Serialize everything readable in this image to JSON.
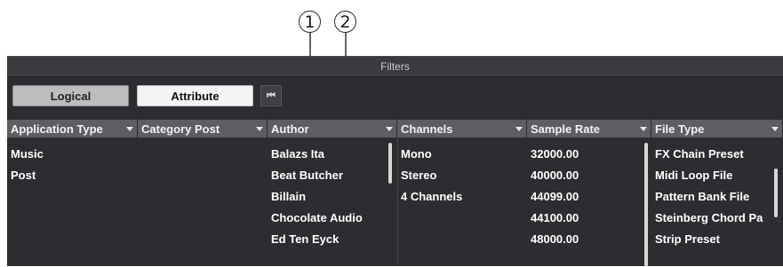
{
  "callouts": [
    "1",
    "2"
  ],
  "panel": {
    "title": "Filters",
    "tabs": {
      "logical": "Logical",
      "attribute": "Attribute",
      "skip_icon": "skip-to-start-icon",
      "skip_glyph": "⏮"
    }
  },
  "columns": [
    {
      "header": "Application Type",
      "items": [
        "Music",
        "Post"
      ]
    },
    {
      "header": "Category Post",
      "items": []
    },
    {
      "header": "Author",
      "items": [
        "Balazs Ita",
        "Beat Butcher",
        "Billain",
        "Chocolate Audio",
        "Ed Ten Eyck"
      ]
    },
    {
      "header": "Channels",
      "items": [
        "Mono",
        "Stereo",
        "4 Channels"
      ]
    },
    {
      "header": "Sample Rate",
      "items": [
        "32000.00",
        "40000.00",
        "44099.00",
        "44100.00",
        "48000.00"
      ]
    },
    {
      "header": "File Type",
      "items": [
        "FX Chain Preset",
        "Midi Loop File",
        "Pattern Bank File",
        "Steinberg Chord Pa",
        "Strip Preset"
      ]
    }
  ]
}
